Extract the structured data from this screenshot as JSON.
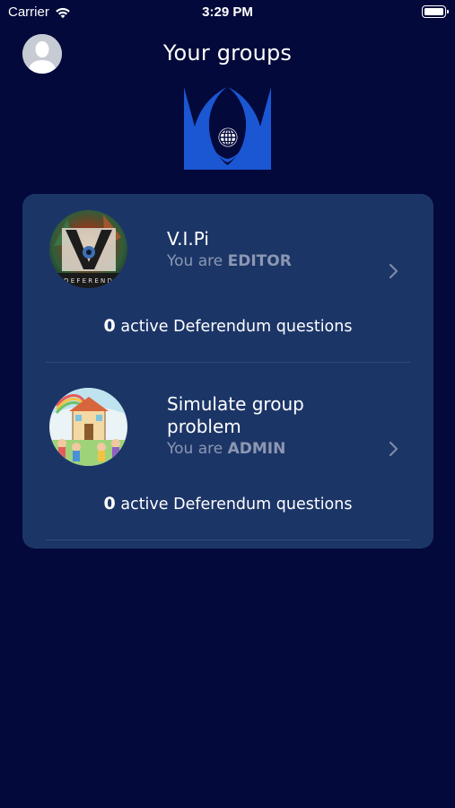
{
  "status_bar": {
    "carrier": "Carrier",
    "time": "3:29 PM"
  },
  "header": {
    "title": "Your groups"
  },
  "groups": [
    {
      "name": "V.I.Pi",
      "role_prefix": "You are",
      "role": "EDITOR",
      "active_count": "0",
      "active_label": "active Deferendum questions"
    },
    {
      "name": "Simulate group problem",
      "role_prefix": "You are",
      "role": "ADMIN",
      "active_count": "0",
      "active_label": "active Deferendum questions"
    }
  ],
  "colors": {
    "background": "#03093a",
    "card": "#1c3567",
    "logo_blue": "#1b56d3",
    "muted_text": "#8c97b1"
  }
}
